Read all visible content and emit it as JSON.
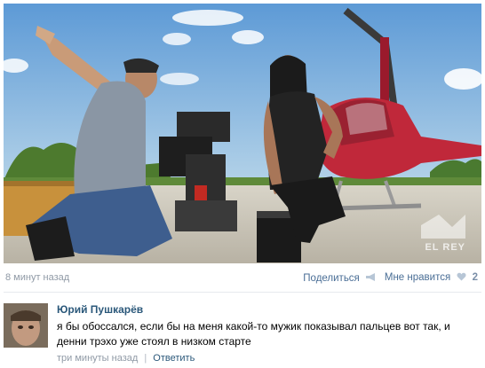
{
  "post": {
    "time": "8 минут назад",
    "share_label": "Поделиться",
    "like_label": "Мне нравится",
    "like_count": "2",
    "watermark_text": "EL REY"
  },
  "comment": {
    "author": "Юрий Пушкарёв",
    "text": "я бы обоссался, если бы на меня какой-то мужик показывал пальцев вот так, и денни трэхо уже стоял в низком старте",
    "time": "три минуты назад",
    "separator": "|",
    "reply_label": "Ответить"
  },
  "colors": {
    "link": "#2b587a",
    "meta": "#909aa6",
    "sky": "#7fb2dc",
    "helicopter": "#c0283a"
  }
}
